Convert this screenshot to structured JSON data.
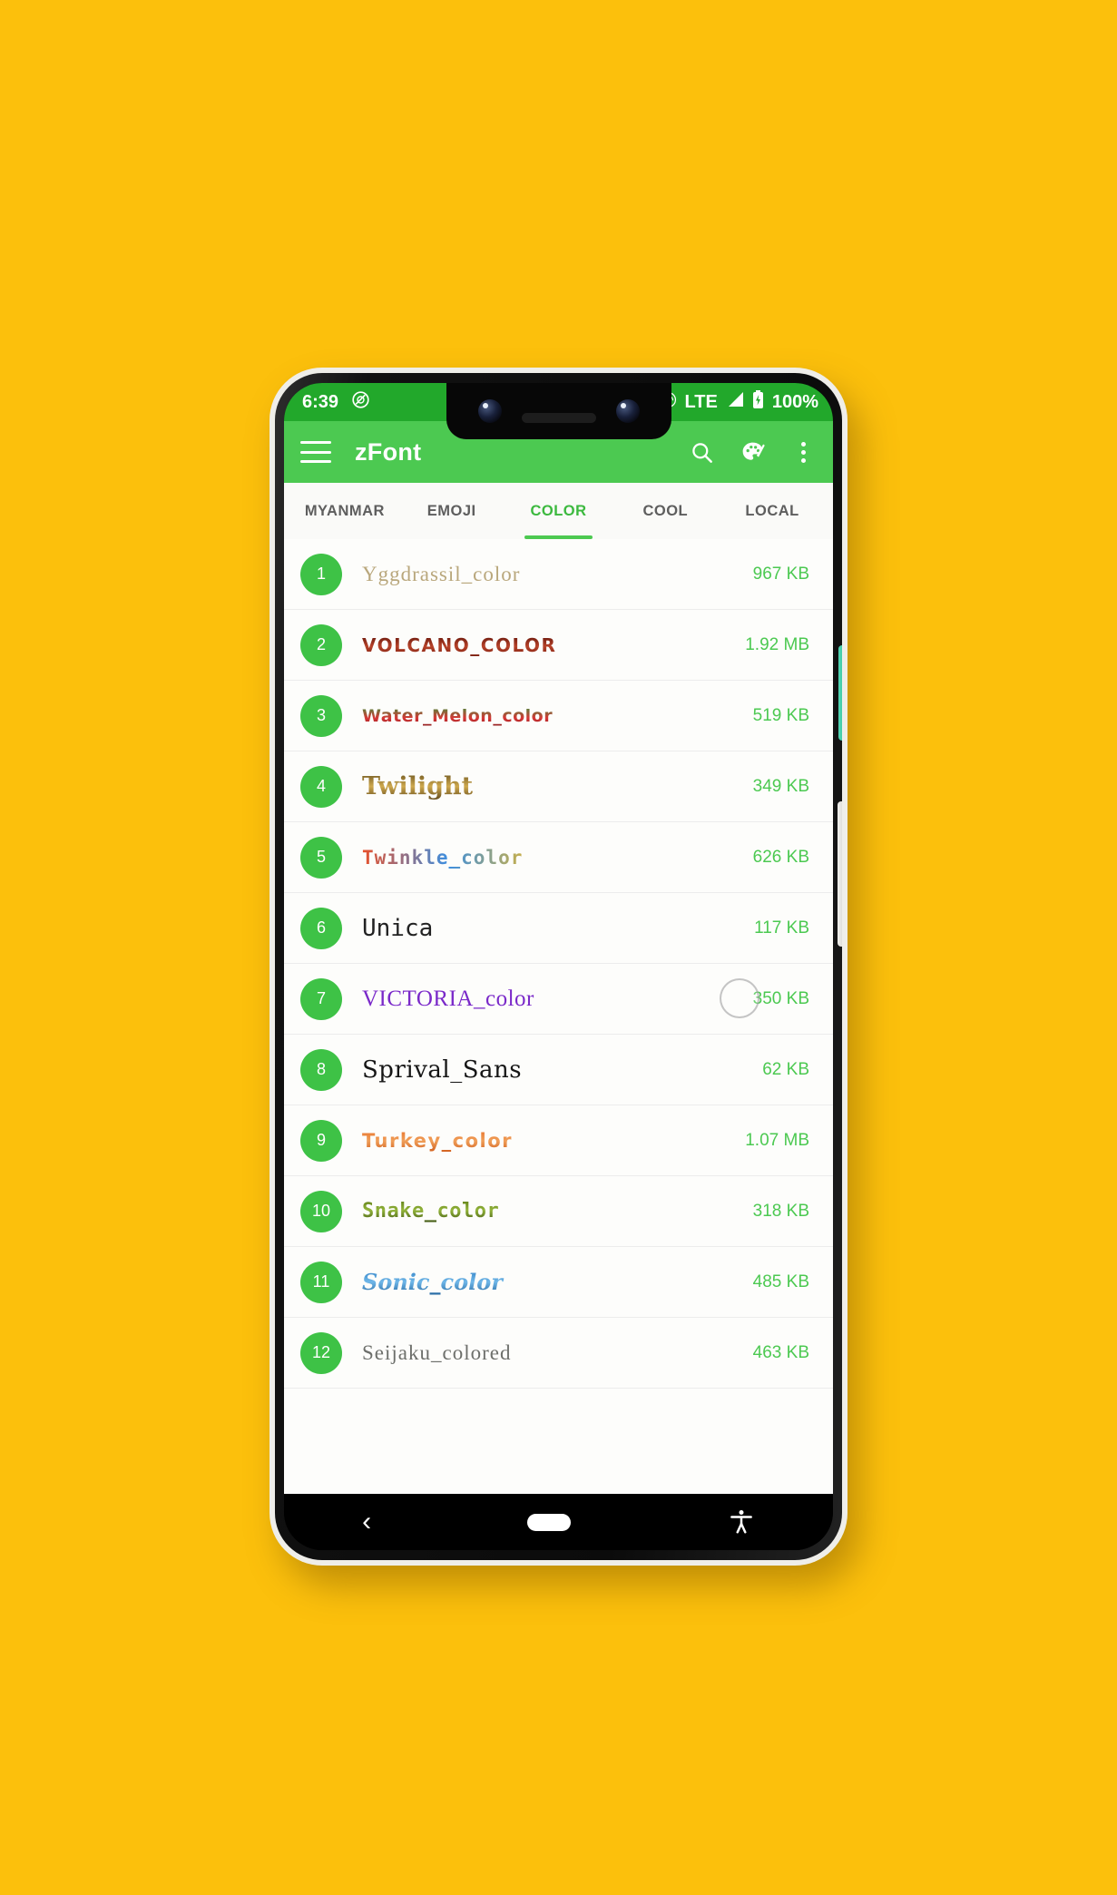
{
  "wallpaper": {
    "background_color": "#fcc00c"
  },
  "device": {
    "frame_color": "#efeee9",
    "side_buttons": [
      {
        "name": "volume-button",
        "color": "#2fc39c"
      },
      {
        "name": "power-button",
        "color": "#f1f0ec"
      }
    ]
  },
  "status_bar": {
    "time": "6:39",
    "left_icons": [
      "do-not-disturb-icon"
    ],
    "network_type": "LTE",
    "right_icons": [
      "hotspot-icon",
      "signal-icon",
      "battery-icon"
    ],
    "battery_percent": "100%",
    "background_color": "#22a82b"
  },
  "app_bar": {
    "menu_icon": "hamburger-icon",
    "title": "zFont",
    "actions": [
      {
        "name": "search-icon",
        "label": "Search"
      },
      {
        "name": "palette-icon",
        "label": "Theme"
      },
      {
        "name": "overflow-menu-icon",
        "label": "More options"
      }
    ],
    "background_color": "#4cc951"
  },
  "tabs": {
    "active_index": 2,
    "items": [
      {
        "label": "MYANMAR"
      },
      {
        "label": "EMOJI"
      },
      {
        "label": "COLOR"
      },
      {
        "label": "COOL"
      },
      {
        "label": "LOCAL"
      }
    ],
    "active_color": "#3cb93f",
    "inactive_color": "#5e5e5e"
  },
  "font_list": {
    "size_color": "#4cc951",
    "badge_color": "#3ec246",
    "rows": [
      {
        "index": "1",
        "name": "Yggdrassil_color",
        "size": "967 KB"
      },
      {
        "index": "2",
        "name": "VOLCANO_COLOR",
        "size": "1.92 MB"
      },
      {
        "index": "3",
        "name": "Water_Melon_color",
        "size": "519 KB"
      },
      {
        "index": "4",
        "name": "Twilight",
        "size": "349 KB"
      },
      {
        "index": "5",
        "name": "Twinkle_color",
        "size": "626 KB"
      },
      {
        "index": "6",
        "name": "Unica",
        "size": "117 KB"
      },
      {
        "index": "7",
        "name": "VICTORIA_color",
        "size": "350 KB"
      },
      {
        "index": "8",
        "name": "Sprival_Sans",
        "size": "62 KB"
      },
      {
        "index": "9",
        "name": "Turkey_color",
        "size": "1.07 MB"
      },
      {
        "index": "10",
        "name": "Snake_color",
        "size": "318 KB"
      },
      {
        "index": "11",
        "name": "Sonic_color",
        "size": "485 KB"
      },
      {
        "index": "12",
        "name": "Seijaku_colored",
        "size": "463 KB"
      }
    ]
  },
  "nav_bar": {
    "items": [
      {
        "name": "back-button",
        "glyph": "‹"
      },
      {
        "name": "home-button",
        "glyph": ""
      },
      {
        "name": "accessibility-button",
        "glyph": ""
      }
    ],
    "background_color": "#000000"
  }
}
